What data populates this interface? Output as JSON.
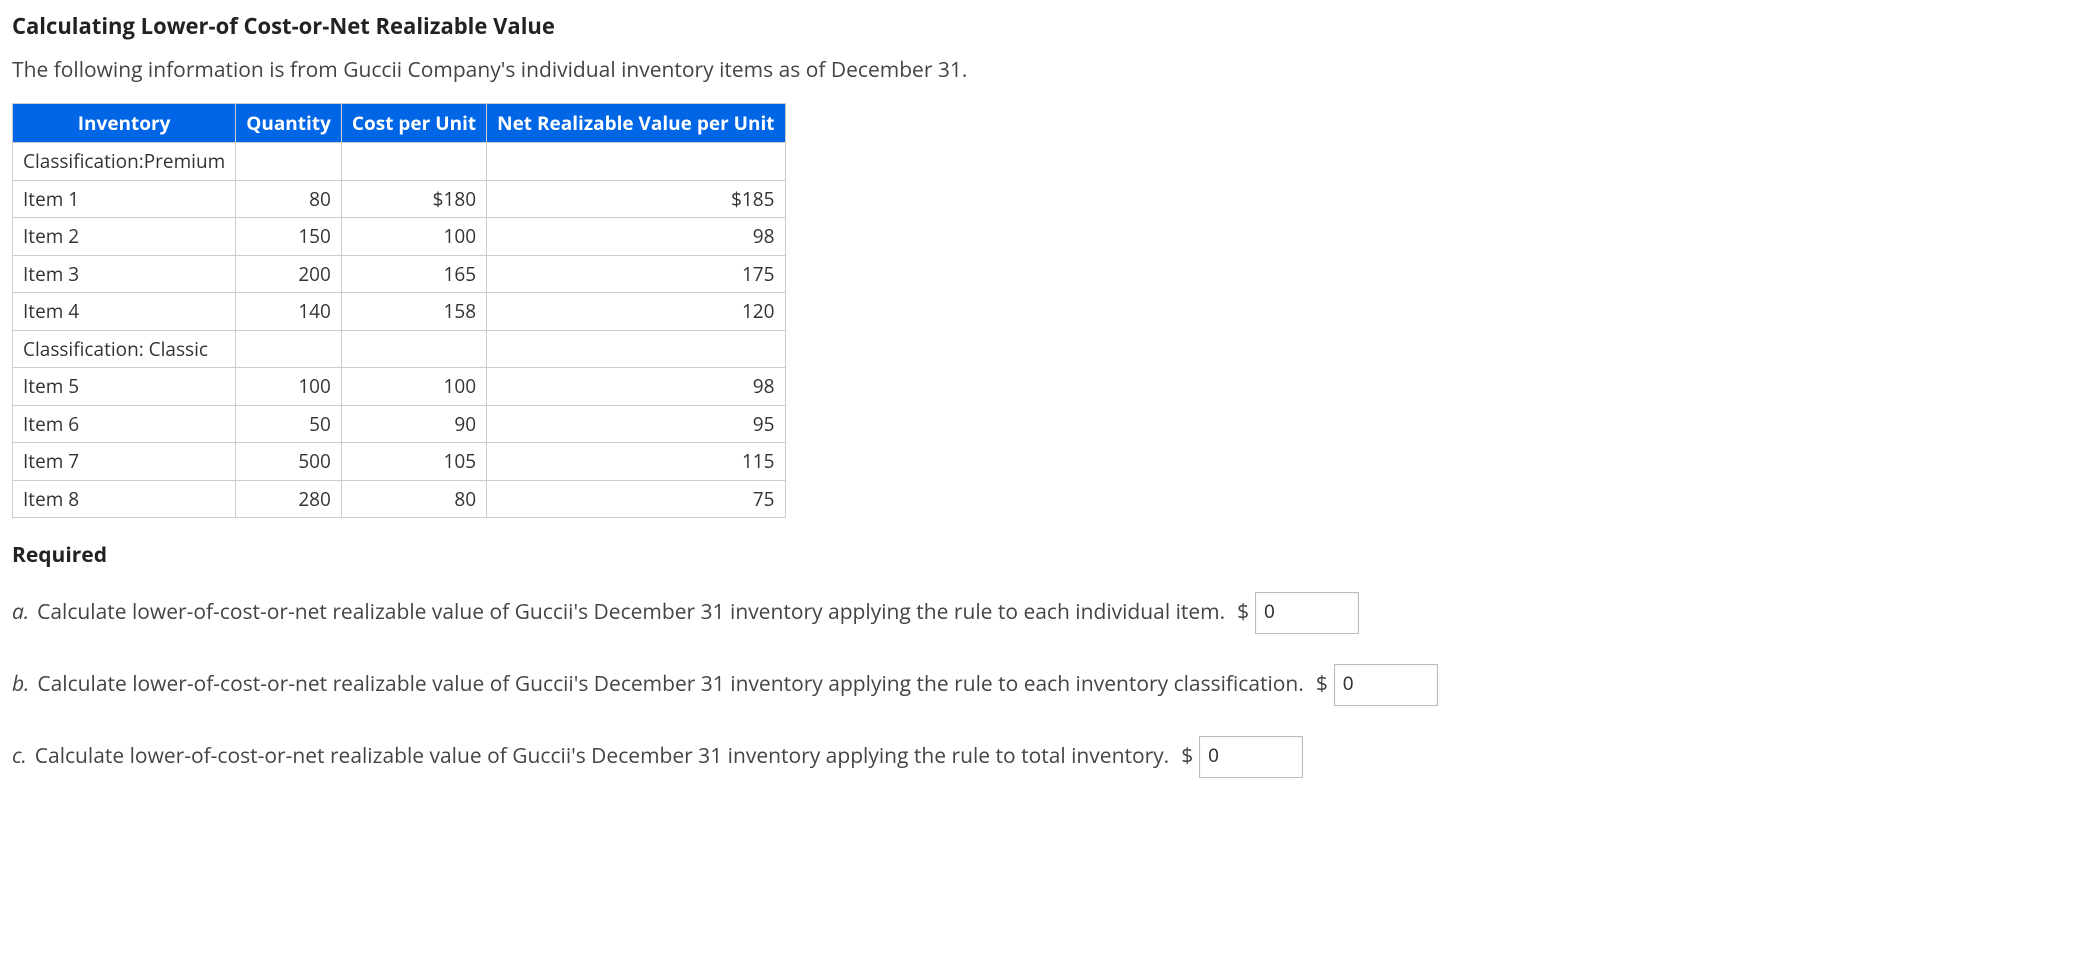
{
  "title": "Calculating Lower-of Cost-or-Net Realizable Value",
  "intro": "The following information is from Guccii Company's individual inventory items as of December 31.",
  "table": {
    "headers": [
      "Inventory",
      "Quantity",
      "Cost per Unit",
      "Net Realizable Value per Unit"
    ],
    "rows": [
      {
        "label": "Classification:Premium",
        "qty": "",
        "cost": "",
        "nrv": ""
      },
      {
        "label": "Item 1",
        "qty": "80",
        "cost": "$180",
        "nrv": "$185"
      },
      {
        "label": "Item 2",
        "qty": "150",
        "cost": "100",
        "nrv": "98"
      },
      {
        "label": "Item 3",
        "qty": "200",
        "cost": "165",
        "nrv": "175"
      },
      {
        "label": "Item 4",
        "qty": "140",
        "cost": "158",
        "nrv": "120"
      },
      {
        "label": "Classification: Classic",
        "qty": "",
        "cost": "",
        "nrv": ""
      },
      {
        "label": "Item 5",
        "qty": "100",
        "cost": "100",
        "nrv": "98"
      },
      {
        "label": "Item 6",
        "qty": "50",
        "cost": "90",
        "nrv": "95"
      },
      {
        "label": "Item 7",
        "qty": "500",
        "cost": "105",
        "nrv": "115"
      },
      {
        "label": "Item 8",
        "qty": "280",
        "cost": "80",
        "nrv": "75"
      }
    ]
  },
  "required_heading": "Required",
  "questions": {
    "a": {
      "letter": "a.",
      "text": "Calculate lower-of-cost-or-net realizable value of Guccii's December 31 inventory applying the rule to each individual item.",
      "currency": "$",
      "value": "0"
    },
    "b": {
      "letter": "b.",
      "text": "Calculate lower-of-cost-or-net realizable value of Guccii's December 31 inventory applying the rule to each inventory classification.",
      "currency": "$",
      "value": "0"
    },
    "c": {
      "letter": "c.",
      "text": "Calculate lower-of-cost-or-net realizable value of Guccii's December 31 inventory applying the rule to total inventory.",
      "currency": "$",
      "value": "0"
    }
  }
}
